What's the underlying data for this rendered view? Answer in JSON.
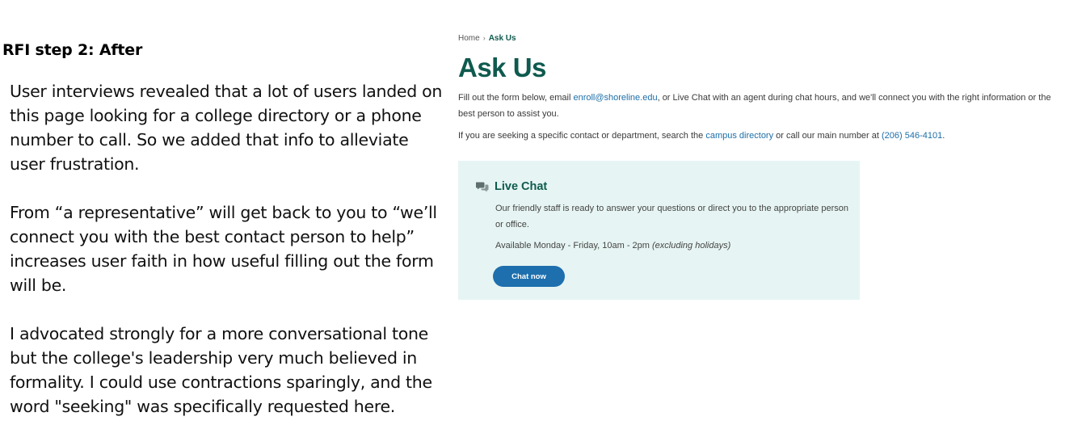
{
  "slide": {
    "heading": "RFI step 2: After",
    "notes": [
      "User interviews revealed that a lot of users landed on this page looking for a college directory or a phone number to call. So we added that info to alleviate user frustration.",
      "From “a representative” will get back to you to “we’ll connect you with the best contact person to help” increases user faith in how useful filling out the form will be.",
      "I advocated strongly for a more conversational tone but the college's leadership very much believed in formality. I could use contractions sparingly, and the word \"seeking\" was specifically requested here."
    ]
  },
  "webpage": {
    "breadcrumb": {
      "home": "Home",
      "separator": "›",
      "current": "Ask Us"
    },
    "title": "Ask Us",
    "intro": {
      "before_email": "Fill out the form below, email ",
      "email": "enroll@shoreline.edu",
      "after_email": ", or Live Chat with an agent during chat hours, and we'll connect you with the right information or the best person to assist you."
    },
    "directory": {
      "before_link": "If you are seeking a specific contact or department, search the ",
      "directory_link": "campus directory",
      "middle": " or call our main number at ",
      "phone": "(206) 546-4101",
      "end": "."
    },
    "live_chat": {
      "icon": "chat-bubbles-icon",
      "title": "Live Chat",
      "description": "Our friendly staff is ready to answer your questions or direct you to the appropriate person or office.",
      "hours": "Available Monday - Friday, 10am - 2pm ",
      "hours_note": "(excluding holidays)",
      "button_label": "Chat now"
    }
  },
  "colors": {
    "brand_green": "#0f5a4e",
    "link_blue": "#1c6fa8",
    "panel_background": "#e6f5f3",
    "button_blue": "#1e6fae"
  }
}
